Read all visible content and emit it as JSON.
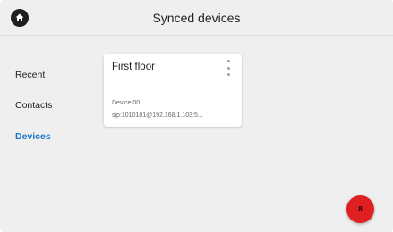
{
  "header": {
    "title": "Synced devices",
    "home_icon": "home-icon"
  },
  "sidebar": {
    "items": [
      {
        "label": "Recent",
        "active": false
      },
      {
        "label": "Contacts",
        "active": false
      },
      {
        "label": "Devices",
        "active": true
      }
    ]
  },
  "devices": [
    {
      "name": "First floor",
      "line1": "Device 00",
      "line2": "sip:1010101@192.168.1.103:5..."
    }
  ],
  "fab": {
    "label": "8",
    "color": "#e02020"
  },
  "colors": {
    "accent": "#1a73c8",
    "background": "#efefef",
    "card": "#ffffff"
  }
}
